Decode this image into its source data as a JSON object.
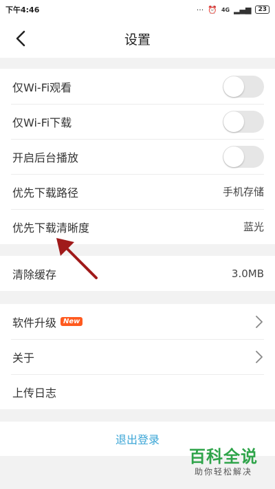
{
  "status_bar": {
    "time": "下午4:46",
    "network": "4G",
    "battery": "23"
  },
  "header": {
    "title": "设置"
  },
  "playback_settings": [
    {
      "label": "仅Wi-Fi观看",
      "type": "toggle",
      "on": false
    },
    {
      "label": "仅Wi-Fi下载",
      "type": "toggle",
      "on": false
    },
    {
      "label": "开启后台播放",
      "type": "toggle",
      "on": false
    },
    {
      "label": "优先下载路径",
      "type": "value",
      "value": "手机存储"
    },
    {
      "label": "优先下载清晰度",
      "type": "value",
      "value": "蓝光"
    }
  ],
  "cache": {
    "label": "清除缓存",
    "value": "3.0MB"
  },
  "misc": [
    {
      "label": "软件升级",
      "badge": "New"
    },
    {
      "label": "关于"
    },
    {
      "label": "上传日志"
    }
  ],
  "logout": {
    "label": "退出登录"
  },
  "watermark": {
    "title": "百科全说",
    "subtitle": "助你轻松解决"
  },
  "colors": {
    "accent": "#3aa5d6",
    "badge": "#ff5a1f",
    "annotation_arrow": "#a01a1a",
    "watermark": "#2fa44a"
  }
}
